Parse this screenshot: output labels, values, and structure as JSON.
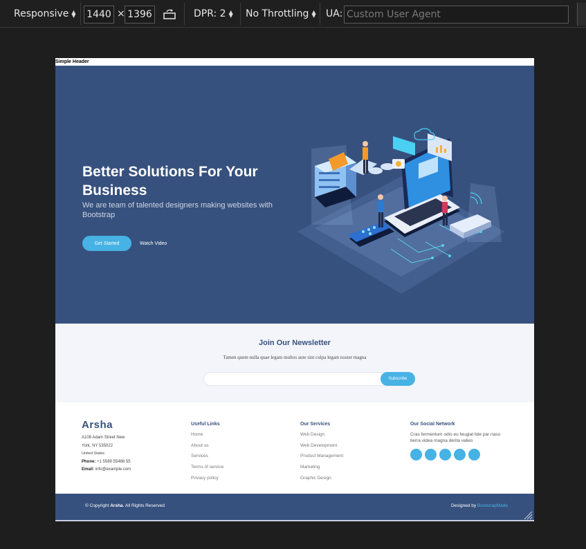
{
  "toolbar": {
    "device": "Responsive",
    "width": "1440",
    "times": "×",
    "height": "1396",
    "dpr": "DPR: 2",
    "throttling": "No Throttling",
    "ua_label": "UA:",
    "ua_placeholder": "Custom User Agent",
    "rotate_icon": "rotate-icon"
  },
  "page": {
    "title": "Simple Header",
    "hero": {
      "heading": "Better Solutions For Your Business",
      "subheading": "We are team of talented designers making websites with Bootstrap",
      "cta": "Get Started",
      "watch": "Watch Video",
      "illustration": "hero-illustration"
    },
    "newsletter": {
      "title": "Join Our Newsletter",
      "text": "Tamen quem nulla quae legam multos aute sint culpa legam noster magna",
      "button": "Subscribe"
    },
    "footer": {
      "brand": "Arsha",
      "address_line1": "A108 Adam Street New",
      "address_line2": "York, NY 535022",
      "address_line3": "United States",
      "phone_label": "Phone:",
      "phone": "+1 5589 55488 55",
      "email_label": "Email:",
      "email": "info@example.com",
      "useful_links_title": "Useful Links",
      "useful_links": [
        "Home",
        "About us",
        "Services",
        "Terms of service",
        "Privacy policy"
      ],
      "services_title": "Our Services",
      "services": [
        "Web Design",
        "Web Development",
        "Product Management",
        "Marketing",
        "Graphic Design"
      ],
      "social_title": "Our Social Network",
      "social_text": "Cras fermentum odio eu feugiat lide par naso tierra videa magna derita valies",
      "social_icons": [
        "twitter-icon",
        "facebook-icon",
        "instagram-icon",
        "skype-icon",
        "linkedin-icon"
      ],
      "copyright_prefix": "© Copyright ",
      "copyright_brand": "Arsha",
      "copyright_suffix": ". All Rights Reserved",
      "designed_by": "Designed by ",
      "designed_link": "BootstrapMade"
    }
  },
  "colors": {
    "hero_bg": "#37517e",
    "accent": "#47b2e4",
    "toolbar_bg": "#1f1f1f",
    "canvas_bg": "#1e1e1e"
  }
}
